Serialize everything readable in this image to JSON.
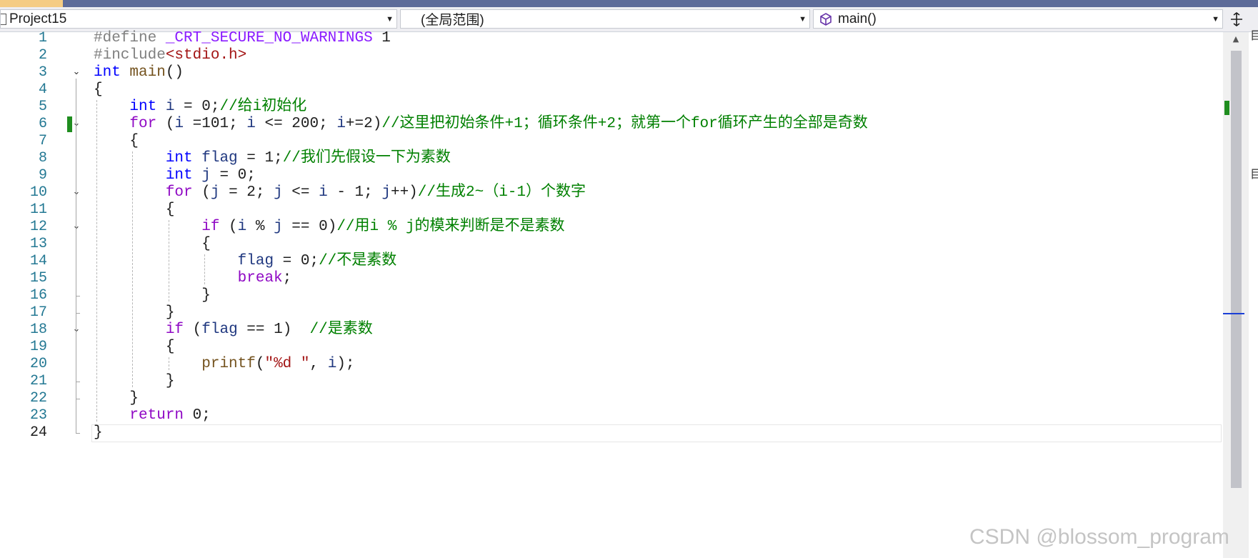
{
  "navbar": {
    "project": "Project15",
    "scope": "(全局范围)",
    "member": "main()",
    "project_icon": "project-file-icon",
    "member_icon": "cube-method-icon",
    "split_icon": "split-view-icon"
  },
  "editor": {
    "current_line": 24,
    "lines": [
      {
        "n": "1",
        "tokens": [
          [
            "pp",
            "#define "
          ],
          [
            "mac",
            "_CRT_SECURE_NO_WARNINGS"
          ],
          [
            "num",
            " 1"
          ]
        ]
      },
      {
        "n": "2",
        "tokens": [
          [
            "pp",
            "#include"
          ],
          [
            "str",
            "<stdio.h>"
          ]
        ]
      },
      {
        "n": "3",
        "tokens": [
          [
            "kw",
            "int"
          ],
          [
            "fn",
            " main"
          ],
          [
            "op",
            "()"
          ]
        ]
      },
      {
        "n": "4",
        "tokens": [
          [
            "op",
            "{"
          ]
        ]
      },
      {
        "n": "5",
        "tokens": [
          [
            "op",
            "    "
          ],
          [
            "kw",
            "int"
          ],
          [
            "op",
            " "
          ],
          [
            "var",
            "i"
          ],
          [
            "op",
            " = 0;"
          ],
          [
            "cmt",
            "//给i初始化"
          ]
        ]
      },
      {
        "n": "6",
        "tokens": [
          [
            "op",
            "    "
          ],
          [
            "ctl",
            "for"
          ],
          [
            "op",
            " ("
          ],
          [
            "var",
            "i"
          ],
          [
            "op",
            " =101; "
          ],
          [
            "var",
            "i"
          ],
          [
            "op",
            " <= 200; "
          ],
          [
            "var",
            "i"
          ],
          [
            "op",
            "+=2)"
          ],
          [
            "cmt",
            "//这里把初始条件+1；循环条件+2；就第一个for循环产生的全部是奇数"
          ]
        ]
      },
      {
        "n": "7",
        "tokens": [
          [
            "op",
            "    {"
          ]
        ]
      },
      {
        "n": "8",
        "tokens": [
          [
            "op",
            "        "
          ],
          [
            "kw",
            "int"
          ],
          [
            "op",
            " "
          ],
          [
            "var",
            "flag"
          ],
          [
            "op",
            " = 1;"
          ],
          [
            "cmt",
            "//我们先假设一下为素数"
          ]
        ]
      },
      {
        "n": "9",
        "tokens": [
          [
            "op",
            "        "
          ],
          [
            "kw",
            "int"
          ],
          [
            "op",
            " "
          ],
          [
            "var",
            "j"
          ],
          [
            "op",
            " = 0;"
          ]
        ]
      },
      {
        "n": "10",
        "tokens": [
          [
            "op",
            "        "
          ],
          [
            "ctl",
            "for"
          ],
          [
            "op",
            " ("
          ],
          [
            "var",
            "j"
          ],
          [
            "op",
            " = 2; "
          ],
          [
            "var",
            "j"
          ],
          [
            "op",
            " <= "
          ],
          [
            "var",
            "i"
          ],
          [
            "op",
            " - 1; "
          ],
          [
            "var",
            "j"
          ],
          [
            "op",
            "++)"
          ],
          [
            "cmt",
            "//生成2~（i-1）个数字"
          ]
        ]
      },
      {
        "n": "11",
        "tokens": [
          [
            "op",
            "        {"
          ]
        ]
      },
      {
        "n": "12",
        "tokens": [
          [
            "op",
            "            "
          ],
          [
            "ctl",
            "if"
          ],
          [
            "op",
            " ("
          ],
          [
            "var",
            "i"
          ],
          [
            "op",
            " % "
          ],
          [
            "var",
            "j"
          ],
          [
            "op",
            " == 0)"
          ],
          [
            "cmt",
            "//用i % j的模来判断是不是素数"
          ]
        ]
      },
      {
        "n": "13",
        "tokens": [
          [
            "op",
            "            {"
          ]
        ]
      },
      {
        "n": "14",
        "tokens": [
          [
            "op",
            "                "
          ],
          [
            "var",
            "flag"
          ],
          [
            "op",
            " = 0;"
          ],
          [
            "cmt",
            "//不是素数"
          ]
        ]
      },
      {
        "n": "15",
        "tokens": [
          [
            "op",
            "                "
          ],
          [
            "ctl",
            "break"
          ],
          [
            "op",
            ";"
          ]
        ]
      },
      {
        "n": "16",
        "tokens": [
          [
            "op",
            "            }"
          ]
        ]
      },
      {
        "n": "17",
        "tokens": [
          [
            "op",
            "        }"
          ]
        ]
      },
      {
        "n": "18",
        "tokens": [
          [
            "op",
            "        "
          ],
          [
            "ctl",
            "if"
          ],
          [
            "op",
            " ("
          ],
          [
            "var",
            "flag"
          ],
          [
            "op",
            " == 1)  "
          ],
          [
            "cmt",
            "//是素数"
          ]
        ]
      },
      {
        "n": "19",
        "tokens": [
          [
            "op",
            "        {"
          ]
        ]
      },
      {
        "n": "20",
        "tokens": [
          [
            "op",
            "            "
          ],
          [
            "fn",
            "printf"
          ],
          [
            "op",
            "("
          ],
          [
            "str",
            "\"%d \""
          ],
          [
            "op",
            ", "
          ],
          [
            "var",
            "i"
          ],
          [
            "op",
            ");"
          ]
        ]
      },
      {
        "n": "21",
        "tokens": [
          [
            "op",
            "        }"
          ]
        ]
      },
      {
        "n": "22",
        "tokens": [
          [
            "op",
            "    }"
          ]
        ]
      },
      {
        "n": "23",
        "tokens": [
          [
            "op",
            "    "
          ],
          [
            "ctl",
            "return"
          ],
          [
            "op",
            " 0;"
          ]
        ]
      },
      {
        "n": "24",
        "tokens": [
          [
            "op",
            "}"
          ]
        ]
      }
    ],
    "fold_lines": [
      "3",
      "6",
      "10",
      "12",
      "18"
    ],
    "changed_lines": [
      "6"
    ],
    "fold_icon": "chevron-down-icon"
  },
  "watermark": "CSDN @blossom_program",
  "colors": {
    "keyword": "#0000ff",
    "control": "#8f08c4",
    "comment": "#008000",
    "string": "#a31515",
    "preprocessor": "#808080",
    "macro": "#8a1bff",
    "variable": "#1f377f",
    "function": "#74531f",
    "line_number": "#237893",
    "change_bar": "#1f8d1f"
  }
}
